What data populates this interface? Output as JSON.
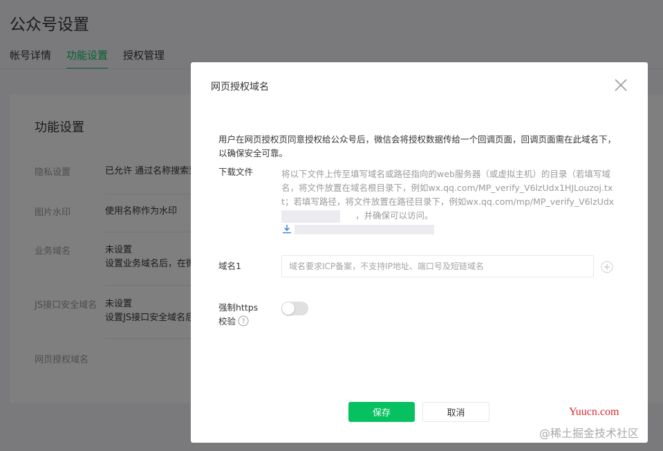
{
  "page": {
    "title": "公众号设置",
    "tabs": [
      {
        "label": "帐号详情",
        "active": false
      },
      {
        "label": "功能设置",
        "active": true
      },
      {
        "label": "授权管理",
        "active": false
      }
    ],
    "card_title": "功能设置",
    "rows": [
      {
        "label": "隐私设置",
        "value": "已允许 通过名称搜索到"
      },
      {
        "label": "图片水印",
        "value": "使用名称作为水印"
      },
      {
        "label": "业务域名",
        "value": "未设置",
        "value2": "设置业务域名后，在微"
      },
      {
        "label": "JS接口安全域名",
        "value": "未设置",
        "value2": "设置JS接口安全域名后"
      },
      {
        "label": "网页授权域名",
        "value": ""
      }
    ]
  },
  "dialog": {
    "title": "网页授权域名",
    "description": "用户在网页授权页同意授权给公众号后，微信会将授权数据传给一个回调页面，回调页面需在此域名下，以确保安全可靠。",
    "download_label": "下载文件",
    "download_text": "将以下文件上传至填写域名或路径指向的web服务器（或虚拟主机）的目录（若填写域名，将文件放置在域名根目录下，例如wx.qq.com/MP_verify_V6lzUdx1HJLouzoj.txt；若填写路径，将文件放置在路径目录下，例如wx.qq.com/mp/MP_verify_V6lzUdx",
    "download_text_tail": "，并确保可以访问。",
    "domain_label": "域名1",
    "domain_placeholder": "域名要求ICP备案，不支持IP地址、端口号及短链域名",
    "https_label_line1": "强制https",
    "https_label_line2": "校验",
    "save_label": "保存",
    "cancel_label": "取消"
  },
  "watermarks": {
    "site": "Yuucn.com",
    "community": "@稀土掘金技术社区"
  },
  "colors": {
    "brand_green": "#07c160",
    "overlay": "rgba(0,0,0,0.5)",
    "watermark_red": "#e0242f"
  }
}
